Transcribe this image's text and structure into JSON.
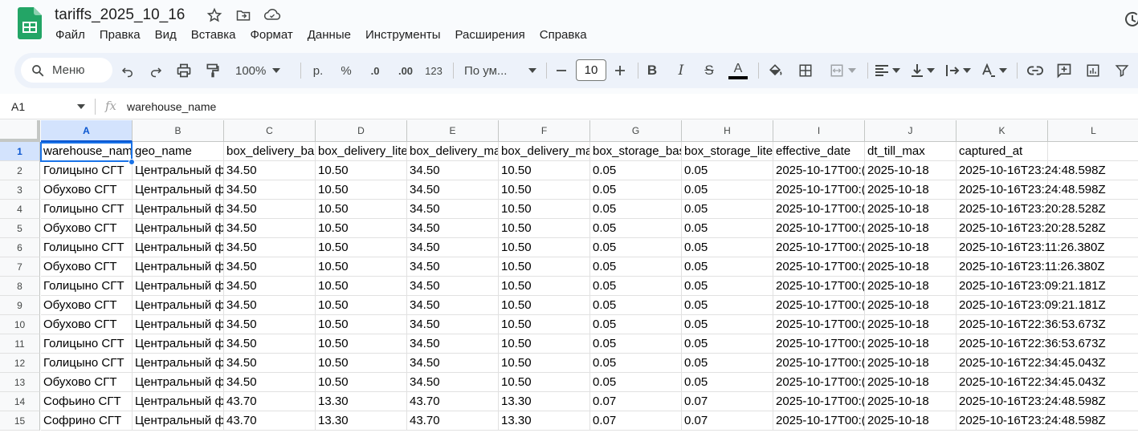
{
  "document": {
    "title": "tariffs_2025_10_16"
  },
  "menu": [
    "Файл",
    "Правка",
    "Вид",
    "Вставка",
    "Формат",
    "Данные",
    "Инструменты",
    "Расширения",
    "Справка"
  ],
  "toolbar": {
    "menu_search": "Меню",
    "zoom": "100%",
    "currency": "р.",
    "percent": "%",
    "decrease_decimal": ".0",
    "increase_decimal": ".00",
    "number_format": "123",
    "font": "По ум...",
    "font_size": "10",
    "text_color": "#000000"
  },
  "formula_bar": {
    "cell_ref": "A1",
    "fx": "fx",
    "content": "warehouse_name"
  },
  "columns": [
    "A",
    "B",
    "C",
    "D",
    "E",
    "F",
    "G",
    "H",
    "I",
    "J",
    "K",
    "L"
  ],
  "rows": [
    [
      "warehouse_nam",
      "geo_name",
      "box_delivery_ba",
      "box_delivery_lite",
      "box_delivery_ma",
      "box_delivery_ma",
      "box_storage_bas",
      "box_storage_lite",
      "effective_date",
      "dt_till_max",
      "captured_at",
      ""
    ],
    [
      "Голицыно СГТ",
      "Центральный ф",
      "34.50",
      "10.50",
      "34.50",
      "10.50",
      "0.05",
      "0.05",
      "2025-10-17T00:(",
      "2025-10-18",
      "2025-10-16T23:24:48.598Z",
      ""
    ],
    [
      "Обухово СГТ",
      "Центральный ф",
      "34.50",
      "10.50",
      "34.50",
      "10.50",
      "0.05",
      "0.05",
      "2025-10-17T00:(",
      "2025-10-18",
      "2025-10-16T23:24:48.598Z",
      ""
    ],
    [
      "Голицыно СГТ",
      "Центральный ф",
      "34.50",
      "10.50",
      "34.50",
      "10.50",
      "0.05",
      "0.05",
      "2025-10-17T00:(",
      "2025-10-18",
      "2025-10-16T23:20:28.528Z",
      ""
    ],
    [
      "Обухово СГТ",
      "Центральный ф",
      "34.50",
      "10.50",
      "34.50",
      "10.50",
      "0.05",
      "0.05",
      "2025-10-17T00:(",
      "2025-10-18",
      "2025-10-16T23:20:28.528Z",
      ""
    ],
    [
      "Голицыно СГТ",
      "Центральный ф",
      "34.50",
      "10.50",
      "34.50",
      "10.50",
      "0.05",
      "0.05",
      "2025-10-17T00:(",
      "2025-10-18",
      "2025-10-16T23:11:26.380Z",
      ""
    ],
    [
      "Обухово СГТ",
      "Центральный ф",
      "34.50",
      "10.50",
      "34.50",
      "10.50",
      "0.05",
      "0.05",
      "2025-10-17T00:(",
      "2025-10-18",
      "2025-10-16T23:11:26.380Z",
      ""
    ],
    [
      "Голицыно СГТ",
      "Центральный ф",
      "34.50",
      "10.50",
      "34.50",
      "10.50",
      "0.05",
      "0.05",
      "2025-10-17T00:(",
      "2025-10-18",
      "2025-10-16T23:09:21.181Z",
      ""
    ],
    [
      "Обухово СГТ",
      "Центральный ф",
      "34.50",
      "10.50",
      "34.50",
      "10.50",
      "0.05",
      "0.05",
      "2025-10-17T00:(",
      "2025-10-18",
      "2025-10-16T23:09:21.181Z",
      ""
    ],
    [
      "Обухово СГТ",
      "Центральный ф",
      "34.50",
      "10.50",
      "34.50",
      "10.50",
      "0.05",
      "0.05",
      "2025-10-17T00:(",
      "2025-10-18",
      "2025-10-16T22:36:53.673Z",
      ""
    ],
    [
      "Голицыно СГТ",
      "Центральный ф",
      "34.50",
      "10.50",
      "34.50",
      "10.50",
      "0.05",
      "0.05",
      "2025-10-17T00:(",
      "2025-10-18",
      "2025-10-16T22:36:53.673Z",
      ""
    ],
    [
      "Голицыно СГТ",
      "Центральный ф",
      "34.50",
      "10.50",
      "34.50",
      "10.50",
      "0.05",
      "0.05",
      "2025-10-17T00:(",
      "2025-10-18",
      "2025-10-16T22:34:45.043Z",
      ""
    ],
    [
      "Обухово СГТ",
      "Центральный ф",
      "34.50",
      "10.50",
      "34.50",
      "10.50",
      "0.05",
      "0.05",
      "2025-10-17T00:(",
      "2025-10-18",
      "2025-10-16T22:34:45.043Z",
      ""
    ],
    [
      "Софьино СГТ",
      "Центральный ф",
      "43.70",
      "13.30",
      "43.70",
      "13.30",
      "0.07",
      "0.07",
      "2025-10-17T00:(",
      "2025-10-18",
      "2025-10-16T23:24:48.598Z",
      ""
    ],
    [
      "Софрино СГТ",
      "Центральный ф",
      "43.70",
      "13.30",
      "43.70",
      "13.30",
      "0.07",
      "0.07",
      "2025-10-17T00:(",
      "2025-10-18",
      "2025-10-16T23:24:48.598Z",
      ""
    ]
  ],
  "active_cell": "A1"
}
